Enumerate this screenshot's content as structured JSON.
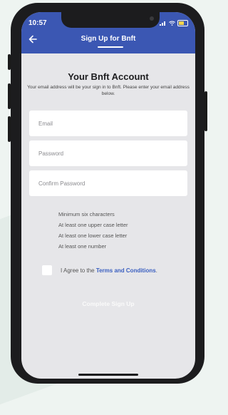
{
  "status": {
    "time": "10:57"
  },
  "header": {
    "title": "Sign Up for Bnft"
  },
  "account": {
    "heading": "Your Bnft Account",
    "subtitle": "Your email address will be your sign in to Bnft. Please enter your email address below."
  },
  "form": {
    "email_placeholder": "Email",
    "password_placeholder": "Password",
    "confirm_placeholder": "Confirm Password"
  },
  "requirements": [
    "Minimum six characters",
    "At least one upper case letter",
    "At least one lower case letter",
    "At least one number"
  ],
  "agree": {
    "prefix": "I Agree to the ",
    "link": "Terms and Conditions",
    "suffix": "."
  },
  "submit_label": "Complete Sign Up",
  "colors": {
    "header": "#3b57b3",
    "link": "#3a5fc0",
    "screen_bg": "#e6e6e9"
  }
}
